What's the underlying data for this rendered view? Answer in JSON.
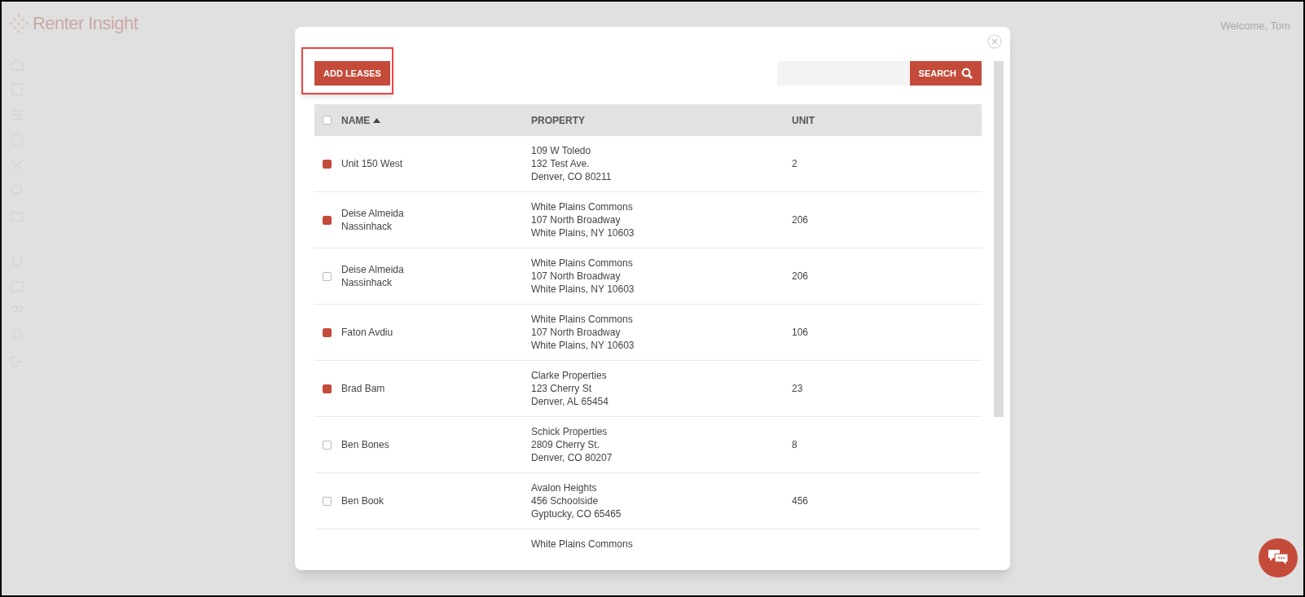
{
  "header": {
    "logo": "Renter Insight",
    "welcome": "Welcome, Tom"
  },
  "modal": {
    "add_button": "ADD LEASES",
    "search": {
      "button": "SEARCH"
    },
    "table": {
      "select_all": {
        "checked": false
      },
      "columns": [
        {
          "label": "NAME",
          "sorted": true
        },
        {
          "label": "PROPERTY",
          "sorted": false
        },
        {
          "label": "UNIT",
          "sorted": false
        }
      ],
      "rows": [
        {
          "checked": true,
          "name": [
            "Unit 150 West"
          ],
          "property": [
            "109 W Toledo",
            "132 Test Ave.",
            "Denver, CO 80211"
          ],
          "unit": "2"
        },
        {
          "checked": true,
          "name": [
            "Deise Almeida",
            "Nassinhack"
          ],
          "property": [
            "White Plains Commons",
            "107 North Broadway",
            "White Plains, NY 10603"
          ],
          "unit": "206"
        },
        {
          "checked": false,
          "name": [
            "Deise Almeida",
            "Nassinhack"
          ],
          "property": [
            "White Plains Commons",
            "107 North Broadway",
            "White Plains, NY 10603"
          ],
          "unit": "206"
        },
        {
          "checked": true,
          "name": [
            "Faton Avdiu"
          ],
          "property": [
            "White Plains Commons",
            "107 North Broadway",
            "White Plains, NY 10603"
          ],
          "unit": "106"
        },
        {
          "checked": true,
          "name": [
            "Brad Bam"
          ],
          "property": [
            "Clarke Properties",
            "123 Cherry St",
            "Denver, AL 65454"
          ],
          "unit": "23"
        },
        {
          "checked": false,
          "name": [
            "Ben Bones"
          ],
          "property": [
            "Schick Properties",
            "2809 Cherry St.",
            "Denver, CO 80207"
          ],
          "unit": "8"
        },
        {
          "checked": false,
          "name": [
            "Ben Book"
          ],
          "property": [
            "Avalon Heights",
            "456 Schoolside",
            "Gyptucky, CO 65465"
          ],
          "unit": "456"
        },
        {
          "name": [],
          "property": [
            "White Plains Commons"
          ],
          "unit": ""
        }
      ]
    }
  }
}
